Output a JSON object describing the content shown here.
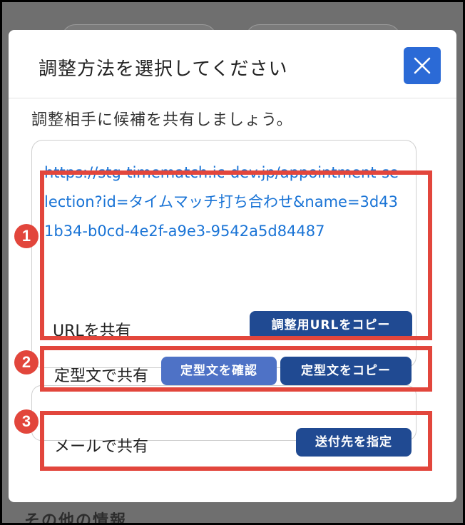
{
  "background": {
    "section_heading": "その他の情報"
  },
  "modal": {
    "title": "調整方法を選択してください",
    "close_icon": "close-icon",
    "intro": "調整相手に候補を共有しましょう。",
    "url": "https://stg-timematch.ic-dev.jp/appointment-selection?id=タイムマッチ打ち合わせ&name=3d431b34-b0cd-4e2f-a9e3-9542a5d84487",
    "url_share": {
      "label": "URLを共有",
      "copy_button": "調整用URLをコピー"
    },
    "template_share": {
      "label": "定型文で共有",
      "confirm_button": "定型文を確認",
      "copy_button": "定型文をコピー"
    },
    "mail_share": {
      "label": "メールで共有",
      "recipient_button": "送付先を指定"
    }
  },
  "annotations": [
    "1",
    "2",
    "3"
  ],
  "colors": {
    "accent": "#2b6ad6",
    "button_dark": "#204a92",
    "button_light": "#4e72c6",
    "link": "#1a74d6",
    "highlight": "#e2463c"
  }
}
